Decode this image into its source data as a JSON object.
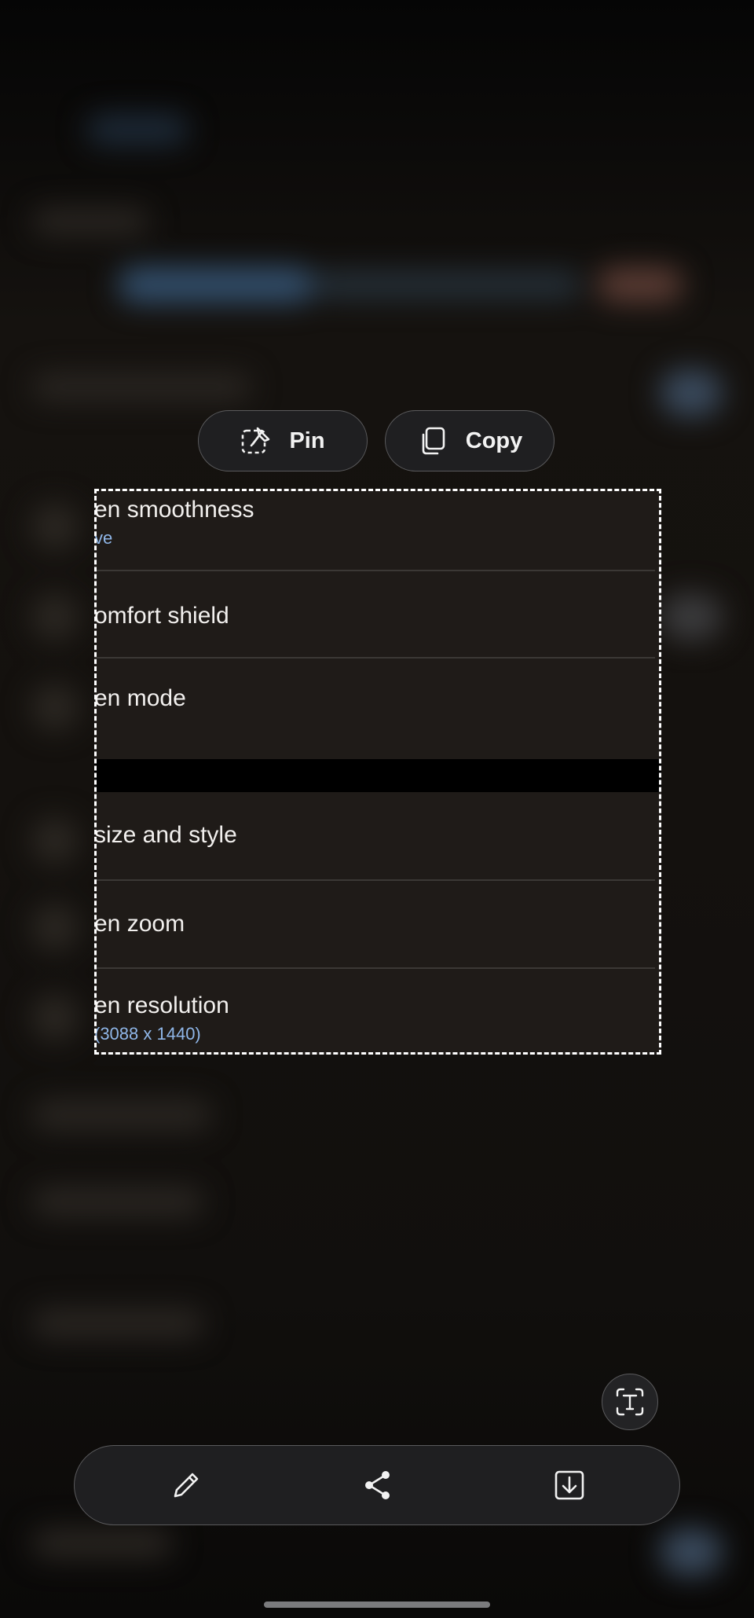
{
  "actions": {
    "pin_label": "Pin",
    "copy_label": "Copy"
  },
  "captured_list": {
    "items": [
      {
        "title": "en smoothness",
        "subtitle": "ve"
      },
      {
        "title": "omfort shield"
      },
      {
        "title": "en mode"
      },
      {
        "title": "size and style"
      },
      {
        "title": "en zoom"
      },
      {
        "title": "en resolution",
        "subtitle": "(3088 x 1440)"
      }
    ]
  },
  "icons": {
    "pin": "pin-icon",
    "copy": "copy-icon",
    "extract_text": "text-extract-icon",
    "edit": "pencil-icon",
    "share": "share-icon",
    "save": "download-icon"
  },
  "colors": {
    "accent_subtitle": "#8fb6e8",
    "chip_bg": "#1f1f21",
    "capture_bg": "#1f1b18"
  }
}
